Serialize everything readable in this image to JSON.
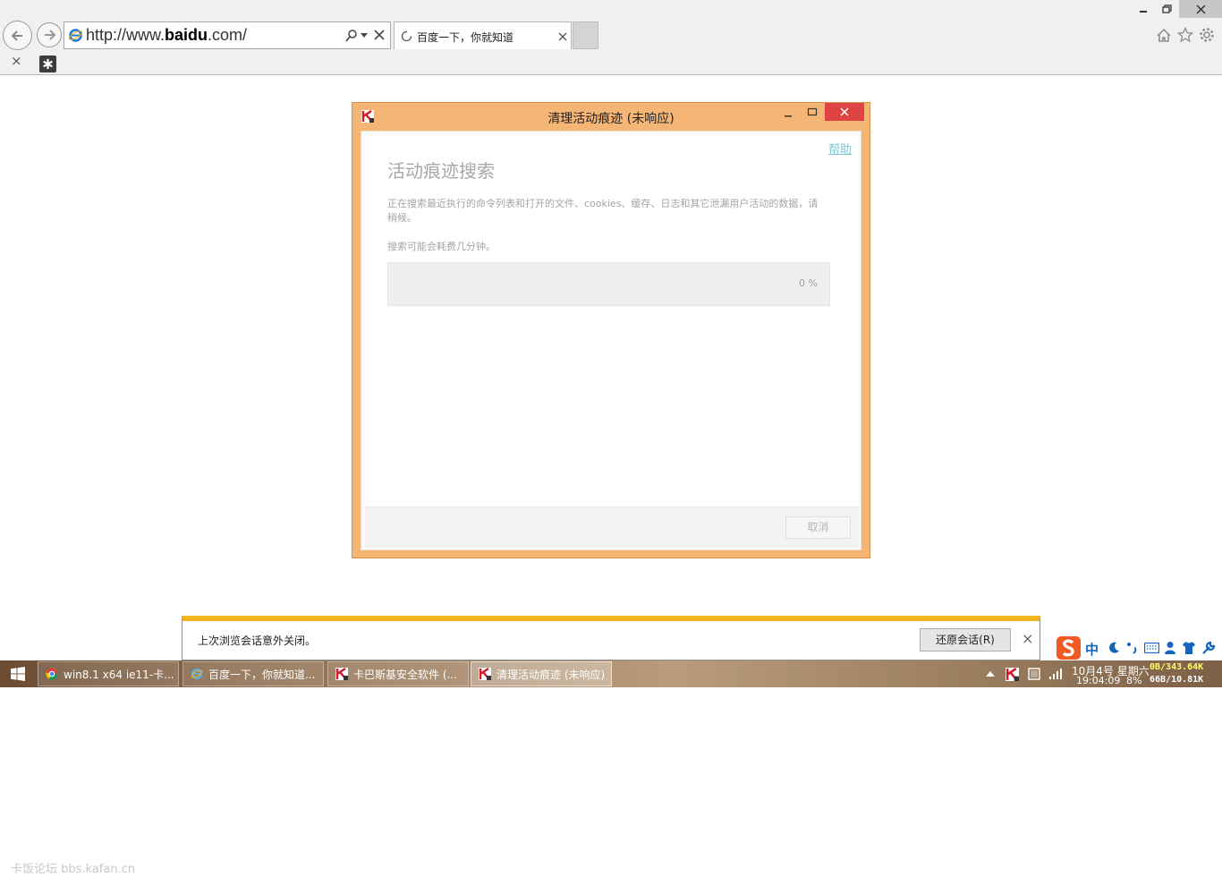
{
  "browser": {
    "address_url_prefix": "http://www.",
    "address_url_domain": "baidu",
    "address_url_suffix": ".com/",
    "tab_title": "百度一下，你就知道",
    "command_close": "×"
  },
  "dialog": {
    "title": "清理活动痕迹 (未响应)",
    "help_link": "帮助",
    "heading": "活动痕迹搜索",
    "description": "正在搜索最近执行的命令列表和打开的文件、cookies、缓存、日志和其它泄漏用户活动的数据，请稍候。",
    "note": "搜索可能会耗费几分钟。",
    "progress_value": 0,
    "progress_label": "0 %",
    "cancel_button": "取消"
  },
  "restore_bar": {
    "message": "上次浏览会话意外关闭。",
    "restore_button": "还原会话(R)",
    "close": "×"
  },
  "taskbar": {
    "items": [
      {
        "label": "win8.1 x64 ie11-卡..."
      },
      {
        "label": "百度一下，你就知道..."
      },
      {
        "label": "卡巴斯基安全软件 (..."
      },
      {
        "label": "清理活动痕迹 (未响应)"
      }
    ],
    "clock_date": "10月4号 星期六",
    "clock_time": "19:04:09",
    "cpu": "8%",
    "net_up": "0B/343.64K",
    "net_down": "66B/10.81K"
  },
  "ime": {
    "mode": "中"
  },
  "watermark": "卡饭论坛 bbs.kafan.cn",
  "colors": {
    "dialog_frame": "#f5b575",
    "dialog_close": "#e04343",
    "restore_accent": "#f2b61d",
    "link": "#7cc6d6"
  }
}
